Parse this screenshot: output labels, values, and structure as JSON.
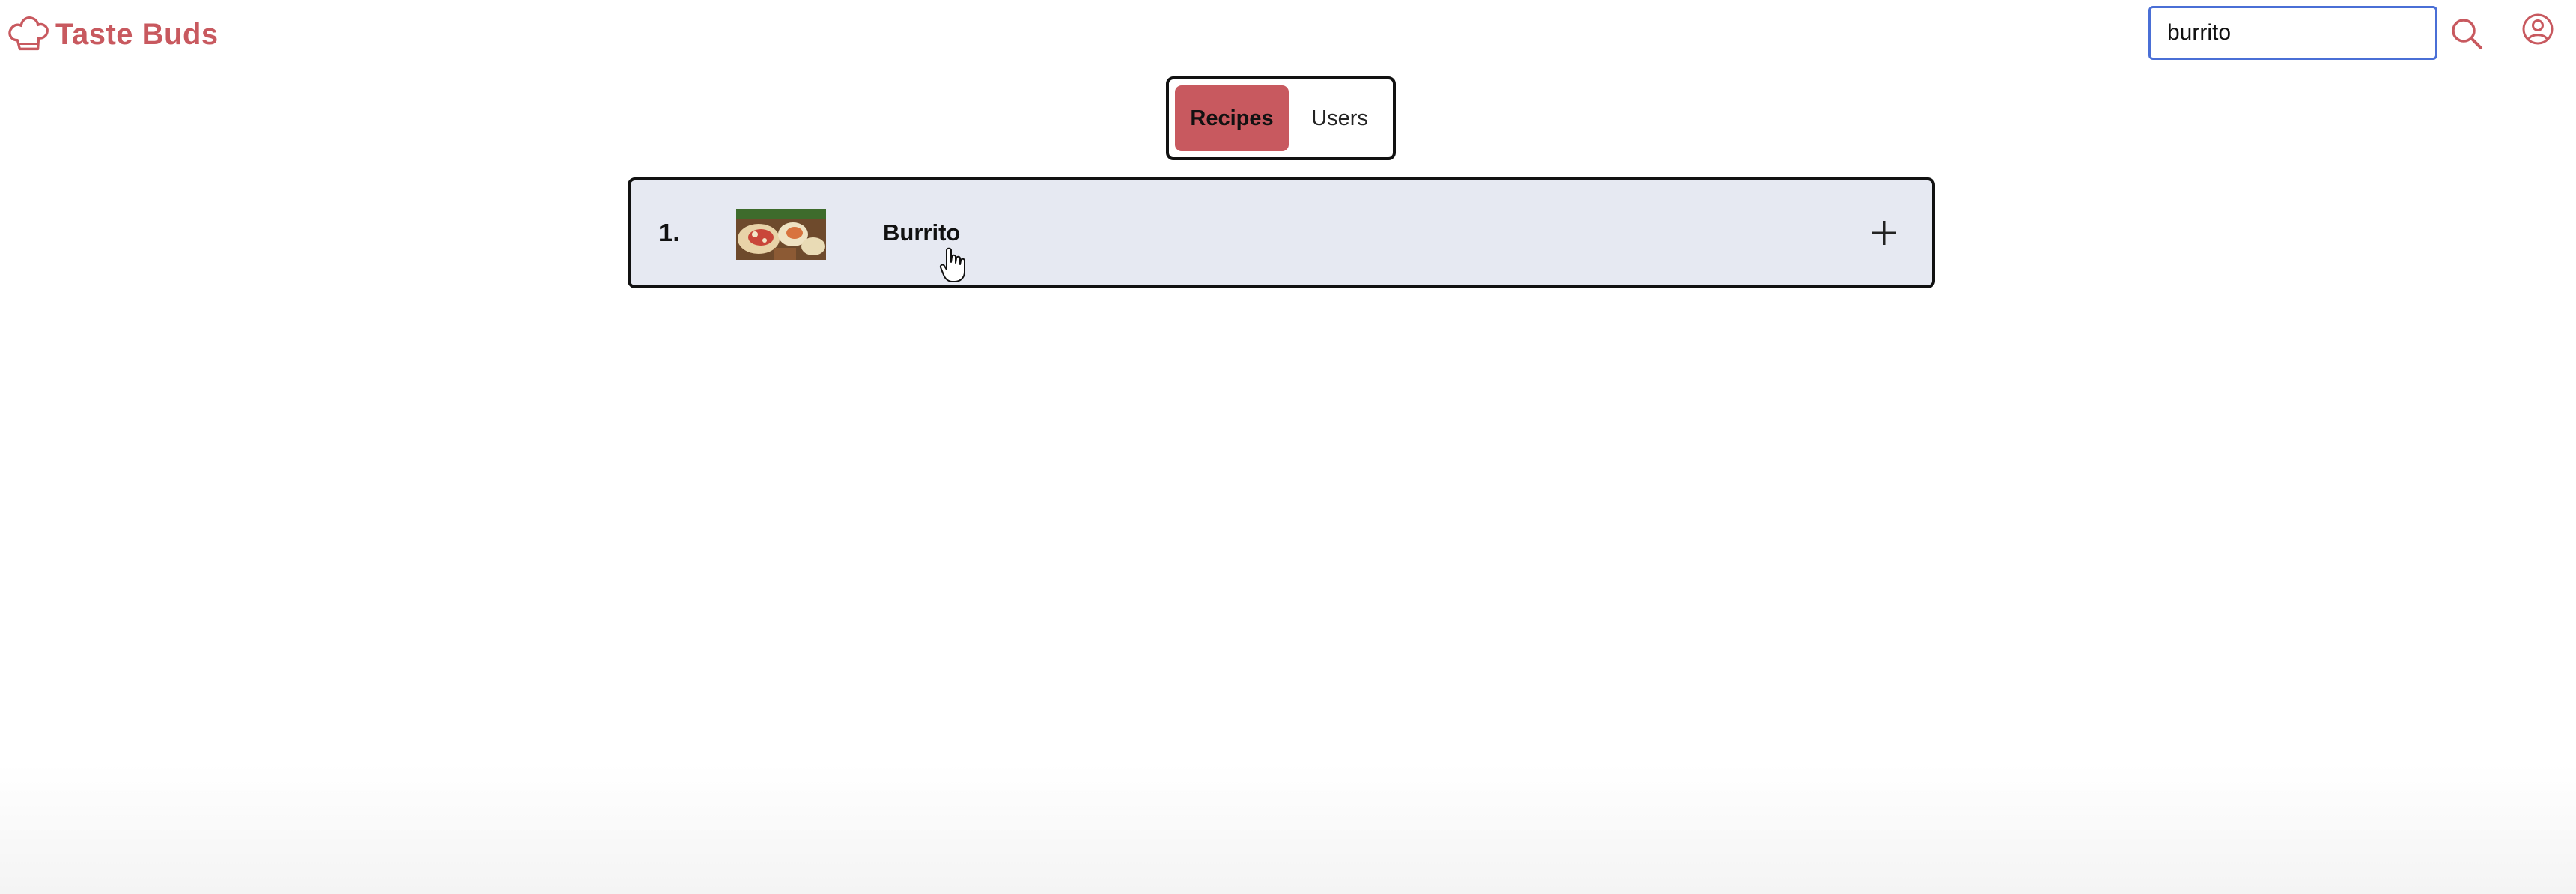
{
  "header": {
    "brand_name": "Taste Buds",
    "search": {
      "value": "burrito",
      "placeholder": ""
    }
  },
  "tabs": [
    {
      "label": "Recipes",
      "active": true
    },
    {
      "label": "Users",
      "active": false
    }
  ],
  "results": [
    {
      "rank": "1.",
      "name": "Burrito",
      "action_icon": "plus-icon"
    }
  ],
  "icons": {
    "brand": "chef-hat-icon",
    "search": "search-icon",
    "account": "user-circle-icon"
  },
  "colors": {
    "brand": "#c8595f",
    "active_tab": "#c8595f",
    "search_focus": "#4a6fd6",
    "result_background": "#e6e9f2"
  }
}
